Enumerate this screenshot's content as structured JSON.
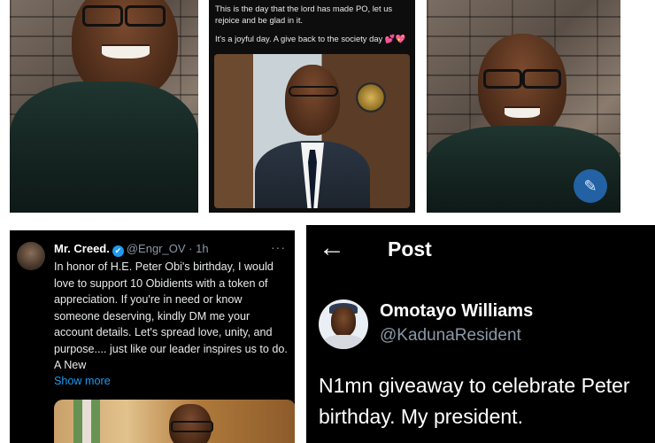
{
  "post_mid": {
    "paragraphs": [
      "This is the day that the lord has made PO, let us rejoice and be glad in it.",
      "It's a joyful day. A give back to the society day 💕💖"
    ]
  },
  "tweet_left": {
    "name": "Mr. Creed.",
    "verified_mark": "✔",
    "handle": "@Engr_OV",
    "separator": "·",
    "time": "1h",
    "more": "···",
    "body": "In honor of H.E. Peter Obi's birthday, I would love to support 10 Obidients with a token of appreciation. If you're in need or know someone deserving, kindly DM me your account details. Let's spread love, unity, and purpose.... just like our leader inspires us to do. A New",
    "show_more": "Show more"
  },
  "post_right": {
    "back_arrow": "←",
    "title": "Post",
    "name": "Omotayo Williams",
    "handle": "@KadunaResident",
    "body": "N1mn giveaway to celebrate Peter birthday. My president."
  },
  "icons": {
    "verified": "verified-badge-icon",
    "back": "back-arrow-icon",
    "more": "more-options-icon",
    "compose": "compose-feather-icon"
  },
  "colors": {
    "link_blue": "#1d9bf0",
    "muted_gray": "#8b98a5",
    "shirt_green": "#1f3530"
  }
}
